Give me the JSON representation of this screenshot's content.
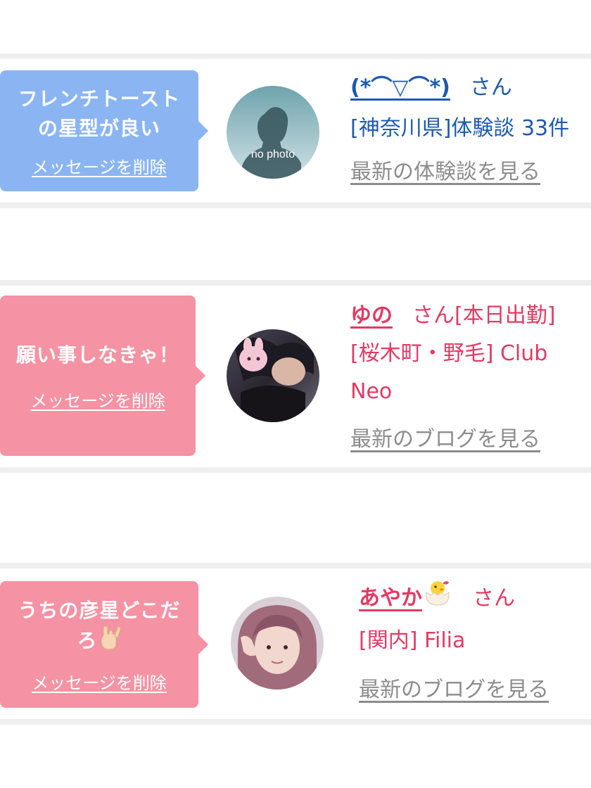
{
  "colors": {
    "blue_bubble": "#8ab5f2",
    "pink_bubble": "#f592a3",
    "blue_text": "#1d5ab0",
    "pink_text": "#e23a63",
    "link_gray": "#8c8c8c",
    "separator": "#efeff0"
  },
  "cards": [
    {
      "message": [
        "フレンチトースト",
        "の星型が良い"
      ],
      "delete_label": "メッセージを削除",
      "avatar_caption": "no photo",
      "name": "(*⌒▽⌒*)",
      "honorific": "さん",
      "detail_lines": [
        "[神奈川県]体験談 33件"
      ],
      "link": "最新の体験談を見る"
    },
    {
      "message": [
        "願い事しなきゃ！"
      ],
      "delete_label": "メッセージを削除",
      "name": "ゆの",
      "honorific": "さん",
      "status": "[本日出勤]",
      "detail_lines": [
        "[桜木町・野毛] Club",
        "Neo"
      ],
      "link": "最新のブログを見る"
    },
    {
      "message": [
        "うちの彦星どこだ",
        "ろ"
      ],
      "delete_label": "メッセージを削除",
      "name": "あやか",
      "honorific": "さん",
      "detail_lines": [
        "[関内] Filia"
      ],
      "link": "最新のブログを見る"
    }
  ]
}
